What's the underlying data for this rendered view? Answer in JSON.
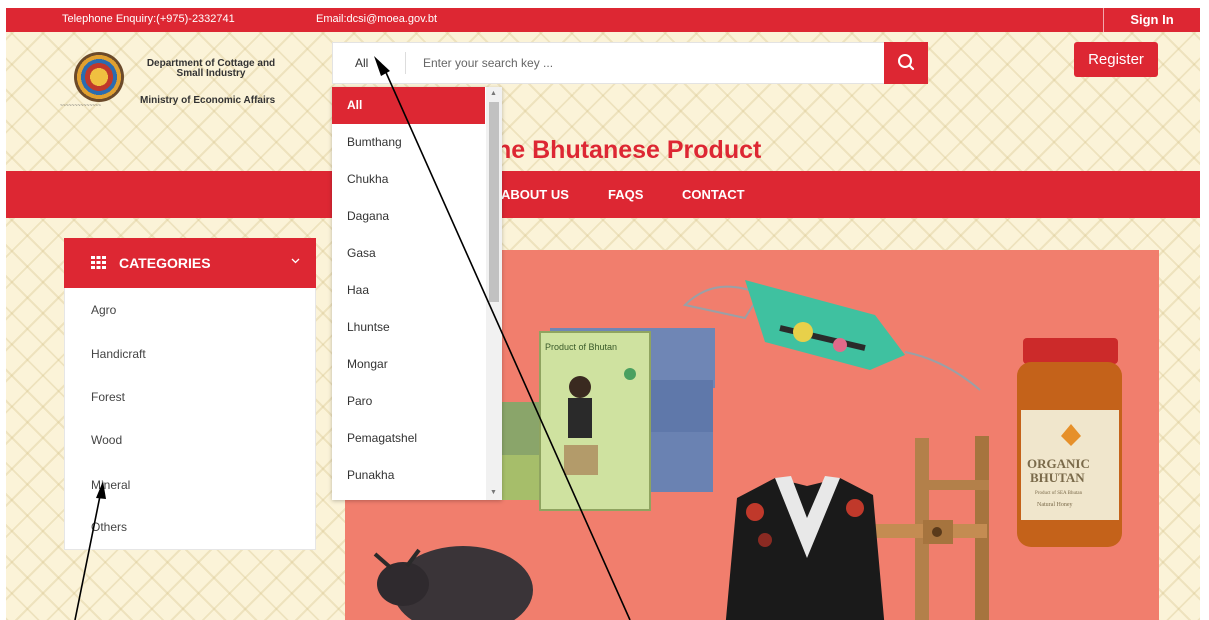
{
  "topbar": {
    "telephone": "Telephone Enquiry:(+975)-2332741",
    "email": "Email:dcsi@moea.gov.bt",
    "sign_in": "Sign In"
  },
  "branding": {
    "department": "Department of Cottage and Small Industry",
    "ministry": "Ministry of Economic Affairs"
  },
  "search": {
    "category_selected": "All",
    "placeholder": "Enter your search key ..."
  },
  "register_label": "Register",
  "tagline": "ne Bhutanese Product",
  "nav": [
    "ABOUT US",
    "FAQS",
    "CONTACT"
  ],
  "categories": {
    "title": "CATEGORIES",
    "items": [
      "Agro",
      "Handicraft",
      "Forest",
      "Wood",
      "Mineral",
      "Others"
    ]
  },
  "dropdown": {
    "options": [
      "All",
      "Bumthang",
      "Chukha",
      "Dagana",
      "Gasa",
      "Haa",
      "Lhuntse",
      "Mongar",
      "Paro",
      "Pemagatshel",
      "Punakha"
    ],
    "selected": "All"
  },
  "banner": {
    "product_box_label": "Product of Bhutan",
    "honey_label_line1": "ORGANIC",
    "honey_label_line2": "BHUTAN",
    "honey_sub1": "Product of SEA Bhutan",
    "honey_sub2": "Natural Honey"
  },
  "colors": {
    "brand_red": "#dd2733",
    "banner_bg": "#f17e6d",
    "page_bg": "#fbf3d8"
  }
}
